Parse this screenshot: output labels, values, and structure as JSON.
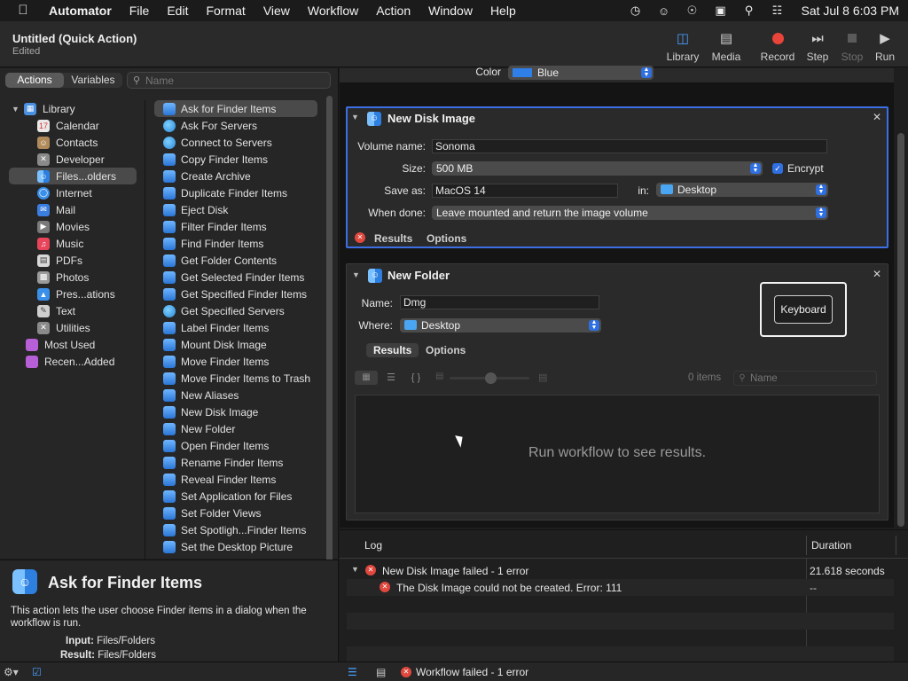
{
  "menubar": {
    "app": "Automator",
    "menus": [
      "File",
      "Edit",
      "Format",
      "View",
      "Workflow",
      "Action",
      "Window",
      "Help"
    ],
    "clock": "Sat Jul 8  6:03 PM"
  },
  "toolbar": {
    "title": "Untitled (Quick Action)",
    "subtitle": "Edited",
    "library": "Library",
    "media": "Media",
    "record": "Record",
    "step": "Step",
    "stop": "Stop",
    "run": "Run"
  },
  "left": {
    "tab_actions": "Actions",
    "tab_variables": "Variables",
    "search_placeholder": "Name",
    "tree": [
      {
        "label": "Library",
        "color": "#4a8fe0"
      },
      {
        "label": "Calendar",
        "color": "#e9e9e9"
      },
      {
        "label": "Contacts",
        "color": "#b08a5a"
      },
      {
        "label": "Developer",
        "color": "#8a8a8a"
      },
      {
        "label": "Files...olders",
        "color": "#4aa6f2"
      },
      {
        "label": "Internet",
        "color": "#3a8fe8"
      },
      {
        "label": "Mail",
        "color": "#3a7fe0"
      },
      {
        "label": "Movies",
        "color": "#7a7a7a"
      },
      {
        "label": "Music",
        "color": "#e8445a"
      },
      {
        "label": "PDFs",
        "color": "#d8d8d8"
      },
      {
        "label": "Photos",
        "color": "#9a9a9a"
      },
      {
        "label": "Pres...ations",
        "color": "#3a8fe8"
      },
      {
        "label": "Text",
        "color": "#cfcfcf"
      },
      {
        "label": "Utilities",
        "color": "#8a8a8a"
      },
      {
        "label": "Most Used",
        "color": "#b75fd6"
      },
      {
        "label": "Recen...Added",
        "color": "#b75fd6"
      }
    ],
    "actions": [
      "Ask for Finder Items",
      "Ask For Servers",
      "Connect to Servers",
      "Copy Finder Items",
      "Create Archive",
      "Duplicate Finder Items",
      "Eject Disk",
      "Filter Finder Items",
      "Find Finder Items",
      "Get Folder Contents",
      "Get Selected Finder Items",
      "Get Specified Finder Items",
      "Get Specified Servers",
      "Label Finder Items",
      "Mount Disk Image",
      "Move Finder Items",
      "Move Finder Items to Trash",
      "New Aliases",
      "New Disk Image",
      "New Folder",
      "Open Finder Items",
      "Rename Finder Items",
      "Reveal Finder Items",
      "Set Application for Files",
      "Set Folder Views",
      "Set Spotligh...Finder Items",
      "Set the Desktop Picture"
    ],
    "desc_title": "Ask for Finder Items",
    "desc_text": "This action lets the user choose Finder items in a dialog when the workflow is run.",
    "input_label": "Input:",
    "input_value": "Files/Folders",
    "result_label": "Result:",
    "result_value": "Files/Folders"
  },
  "workflow": {
    "color_label": "Color",
    "color_value": "Blue",
    "disk": {
      "title": "New Disk Image",
      "volume_label": "Volume name:",
      "volume_value": "Sonoma",
      "size_label": "Size:",
      "size_value": "500 MB",
      "encrypt_label": "Encrypt",
      "saveas_label": "Save as:",
      "saveas_value": "MacOS 14",
      "in_label": "in:",
      "in_value": "Desktop",
      "whendone_label": "When done:",
      "whendone_value": "Leave mounted and return the image volume",
      "results": "Results",
      "options": "Options"
    },
    "folder": {
      "title": "New Folder",
      "name_label": "Name:",
      "name_value": "Dmg",
      "where_label": "Where:",
      "where_value": "Desktop",
      "keyboard": "Keyboard",
      "results": "Results",
      "options": "Options",
      "items_count": "0 items",
      "search_placeholder": "Name",
      "empty_text": "Run workflow to see results."
    }
  },
  "log": {
    "col_log": "Log",
    "col_duration": "Duration",
    "row1_text": "New Disk Image failed - 1 error",
    "row1_duration": "21.618 seconds",
    "row2_text": "The Disk Image could not be created. Error: 111",
    "row2_duration": "--"
  },
  "status": {
    "text": "Workflow failed - 1 error"
  }
}
